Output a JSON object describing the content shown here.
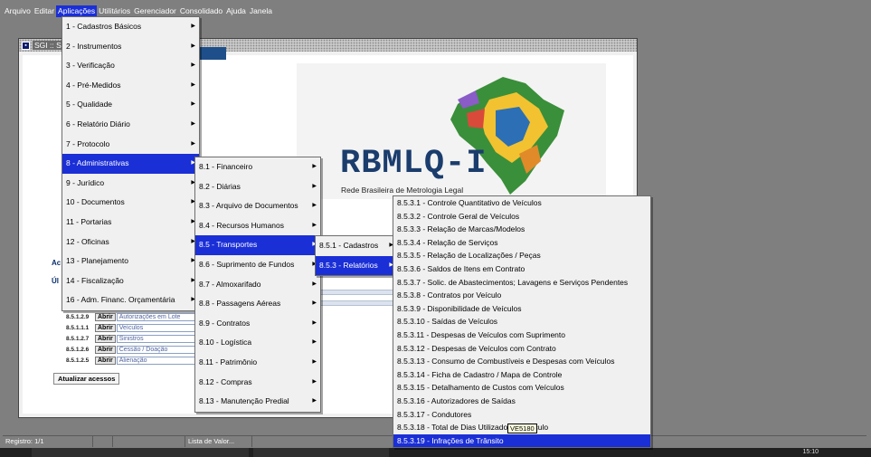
{
  "menubar": [
    "Arquivo",
    "Editar",
    "Aplicações",
    "Utilitários",
    "Gerenciador",
    "Consolidado",
    "Ajuda",
    "Janela"
  ],
  "window": {
    "title": "SGI :: S"
  },
  "logo": {
    "name": "RBMLQ-I",
    "subtitle": "Rede Brasileira de Metrologia Legal"
  },
  "labels": {
    "acessos": "Ac",
    "ultimos": "Úl"
  },
  "access_rows": [
    {
      "code": "8.5.1.2.9",
      "button": "Abrir",
      "desc": "Autorizações em Lote"
    },
    {
      "code": "8.5.1.1.1",
      "button": "Abrir",
      "desc": "Veículos"
    },
    {
      "code": "8.5.1.2.7",
      "button": "Abrir",
      "desc": "Sinistros"
    },
    {
      "code": "8.5.1.2.6",
      "button": "Abrir",
      "desc": "Cessão / Doação"
    },
    {
      "code": "8.5.1.2.5",
      "button": "Abrir",
      "desc": "Alienação"
    }
  ],
  "refresh_button": "Atualizar acessos",
  "status": {
    "registro": "Registro: 1/1",
    "lista": "Lista de Valor...",
    "clock": "15:10"
  },
  "menu1": [
    "1 - Cadastros Básicos",
    "2 - Instrumentos",
    "3 - Verificação",
    "4 - Pré-Medidos",
    "5 - Qualidade",
    "6 - Relatório Diário",
    "7 - Protocolo",
    "8 - Administrativas",
    "9 - Jurídico",
    "10 - Documentos",
    "11 - Portarias",
    "12 - Oficinas",
    "13 - Planejamento",
    "14 - Fiscalização",
    "16 - Adm. Financ. Orçamentária"
  ],
  "menu2": [
    "8.1 - Financeiro",
    "8.2 - Diárias",
    "8.3 - Arquivo de Documentos",
    "8.4 - Recursos Humanos",
    "8.5 - Transportes",
    "8.6 - Suprimento de Fundos",
    "8.7 - Almoxarifado",
    "8.8 - Passagens Aéreas",
    "8.9 - Contratos",
    "8.10 - Logística",
    "8.11 - Patrimônio",
    "8.12 - Compras",
    "8.13 - Manutenção Predial"
  ],
  "menu2b": [
    "8.5.1 - Cadastros",
    "8.5.3 - Relatórios"
  ],
  "menu3": [
    "8.5.3.1 - Controle Quantitativo de Veículos",
    "8.5.3.2 - Controle Geral de Veículos",
    "8.5.3.3 - Relação de Marcas/Modelos",
    "8.5.3.4 - Relação de Serviços",
    "8.5.3.5 - Relação de Localizações / Peças",
    "8.5.3.6 - Saldos de Itens em Contrato",
    "8.5.3.7 - Solic. de Abastecimentos; Lavagens e Serviços Pendentes",
    "8.5.3.8 - Contratos por Veículo",
    "8.5.3.9 - Disponibilidade de Veículos",
    "8.5.3.10 - Saídas de Veículos",
    "8.5.3.11 - Despesas de Veículos com Suprimento",
    "8.5.3.12 - Despesas de Veículos com Contrato",
    "8.5.3.13 - Consumo de Combustíveis e Despesas com Veículos",
    "8.5.3.14 - Ficha de Cadastro / Mapa de Controle",
    "8.5.3.15 - Detalhamento de Custos com Veículos",
    "8.5.3.16 - Autorizadores de Saídas",
    "8.5.3.17 - Condutores",
    "8.5.3.18 - Total de Dias Utilizado por Veículo",
    "8.5.3.19 - Infrações de Trânsito"
  ],
  "tooltip": "VE5180"
}
